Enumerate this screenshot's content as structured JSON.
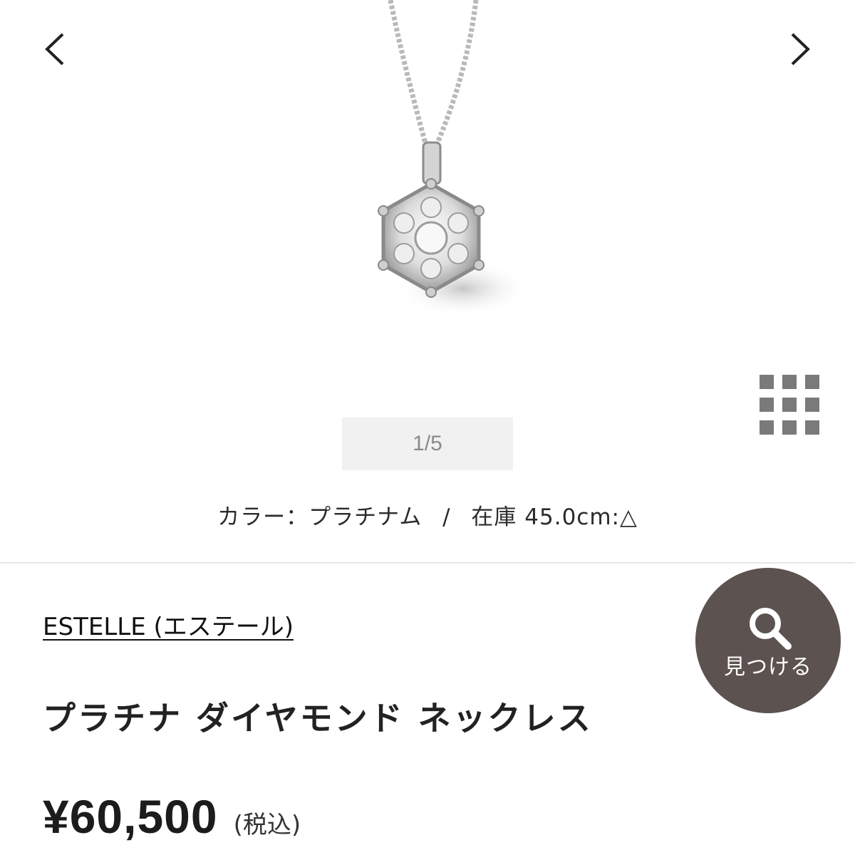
{
  "gallery": {
    "image_label": "platinum diamond hexagon pendant necklace",
    "counter": "1/5",
    "prev_icon": "chevron-left-icon",
    "next_icon": "chevron-right-icon",
    "grid_icon": "grid-icon"
  },
  "variant": {
    "color_label": "カラー：プラチナム",
    "separator": "/",
    "stock_label": "在庫",
    "stock_value": "45.0cm:△"
  },
  "product": {
    "brand": "ESTELLE (エステール)",
    "name": "プラチナ ダイヤモンド ネックレス",
    "price": "¥60,500",
    "tax_note": "(税込)"
  },
  "find_button": {
    "icon": "search-icon",
    "label": "見つける"
  },
  "colors": {
    "find_button_bg": "#5c5250",
    "counter_bg": "#f1f1f1",
    "grid_icon": "#7a7a7a"
  }
}
